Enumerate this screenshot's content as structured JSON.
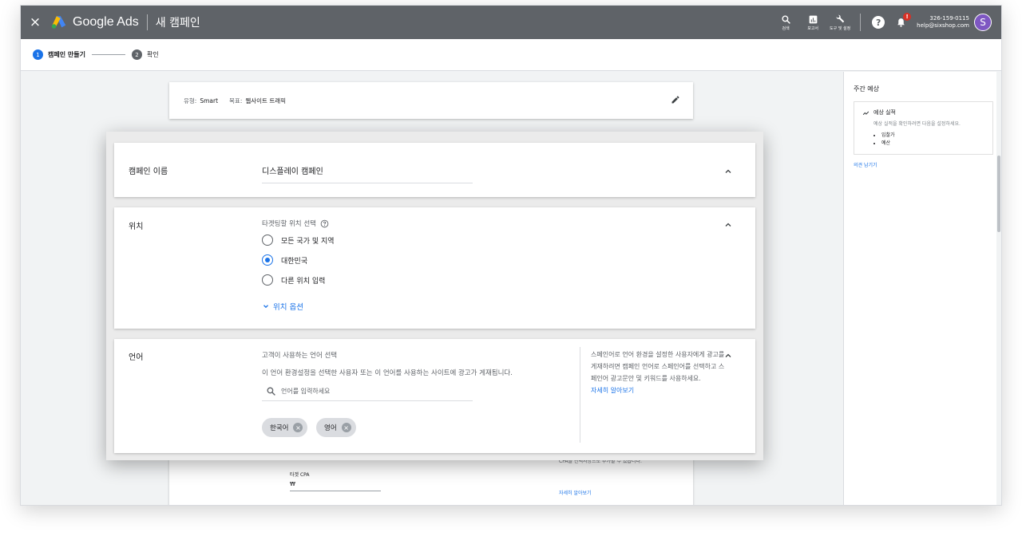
{
  "header": {
    "close": "×",
    "brand": "Google Ads",
    "title": "새 캠페인",
    "tools": [
      {
        "icon": "search-icon",
        "label": "검색"
      },
      {
        "icon": "reports-icon",
        "label": "보고서"
      },
      {
        "icon": "wrench-icon",
        "label": "도구 및 설정"
      }
    ],
    "help": "?",
    "notification_badge": "!",
    "account_id": "326-159-0115",
    "account_email": "help@sixshop.com",
    "avatar_letter": "S"
  },
  "stepper": {
    "steps": [
      {
        "num": "1",
        "label": "캠페인 만들기",
        "active": true
      },
      {
        "num": "2",
        "label": "확인",
        "active": false
      }
    ]
  },
  "summary": {
    "type_label": "유형:",
    "type_value": "Smart",
    "goal_label": "목표:",
    "goal_value": "웹사이트 트래픽"
  },
  "campaign_name": {
    "label": "캠페인 이름",
    "value": "디스플레이 캠페인"
  },
  "location": {
    "label": "위치",
    "prompt": "타겟팅할 위치 선택",
    "options": [
      "모든 국가 및 지역",
      "대한민국",
      "다른 위치 입력"
    ],
    "selected_index": 1,
    "more_options": "위치 옵션"
  },
  "language": {
    "label": "언어",
    "prompt": "고객이 사용하는 언어 선택",
    "description": "이 언어 환경설정을 선택한 사용자 또는 이 언어를 사용하는 사이트에 광고가 게재됩니다.",
    "search_placeholder": "언어를 입력하세요",
    "chips": [
      "한국어",
      "영어"
    ],
    "help_text": "스페인어로 언어 환경을 설정한 사용자에게 광고를 게재하려면 캠페인 언어로 스페인어를 선택하고 스페인어 광고문안 및 키워드를 사용하세요.",
    "help_link": "자세히 알아보기"
  },
  "background_card": {
    "cpa_label": "타겟 CPA",
    "cpa_currency": "₩",
    "note": "CPA를 선택사항으로 추가할 수 있습니다.",
    "link": "자세히 알아보기"
  },
  "right_panel": {
    "title": "주간 예상",
    "box_title": "예상 실적",
    "box_desc": "예상 실적을 확인하려면 다음을 설정하세요.",
    "items": [
      "입찰가",
      "예산"
    ],
    "feedback_link": "의견 남기기"
  },
  "colors": {
    "topbar": "#5f6368",
    "accent": "#1a73e8",
    "avatar": "#7e57c2",
    "badge": "#d93025"
  }
}
